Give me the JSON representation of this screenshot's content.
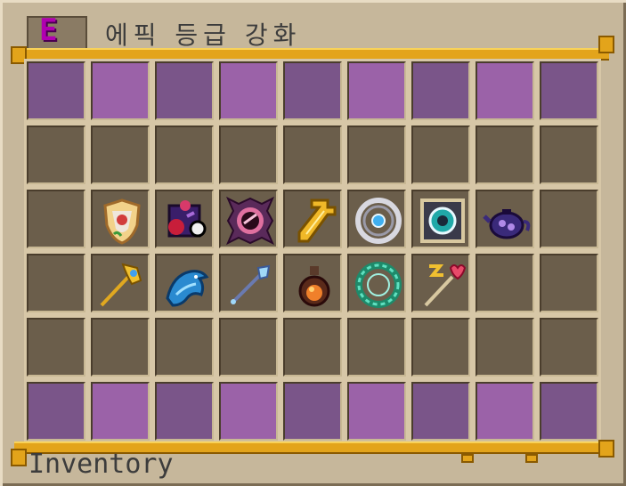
{
  "title": {
    "badge_letter": "E",
    "text": "에픽 등급 강화"
  },
  "footer": {
    "label": "Inventory"
  },
  "grid": {
    "columns": 9,
    "rows": 6,
    "row_styles": [
      "purple",
      "dark",
      "dark",
      "dark",
      "dark",
      "purple"
    ]
  },
  "items": [
    {
      "row": 2,
      "col": 1,
      "icon": "crested-shield-icon"
    },
    {
      "row": 2,
      "col": 2,
      "icon": "crimson-dark-orb-icon"
    },
    {
      "row": 2,
      "col": 3,
      "icon": "eye-rune-icon"
    },
    {
      "row": 2,
      "col": 4,
      "icon": "golden-cross-icon"
    },
    {
      "row": 2,
      "col": 5,
      "icon": "silver-ring-icon"
    },
    {
      "row": 2,
      "col": 6,
      "icon": "cyan-core-icon"
    },
    {
      "row": 2,
      "col": 7,
      "icon": "purple-teapot-icon"
    },
    {
      "row": 3,
      "col": 1,
      "icon": "golden-staff-icon"
    },
    {
      "row": 3,
      "col": 2,
      "icon": "blue-dolphin-icon"
    },
    {
      "row": 3,
      "col": 3,
      "icon": "crystal-staff-icon"
    },
    {
      "row": 3,
      "col": 4,
      "icon": "orange-potion-icon"
    },
    {
      "row": 3,
      "col": 5,
      "icon": "emerald-wreath-icon"
    },
    {
      "row": 3,
      "col": 6,
      "icon": "heart-wand-icon"
    }
  ],
  "colors": {
    "purple_dark": "#7a5589",
    "purple_light": "#9b62a8",
    "slot_dark": "#6b5e4b",
    "frame_gold": "#e3a41b"
  }
}
